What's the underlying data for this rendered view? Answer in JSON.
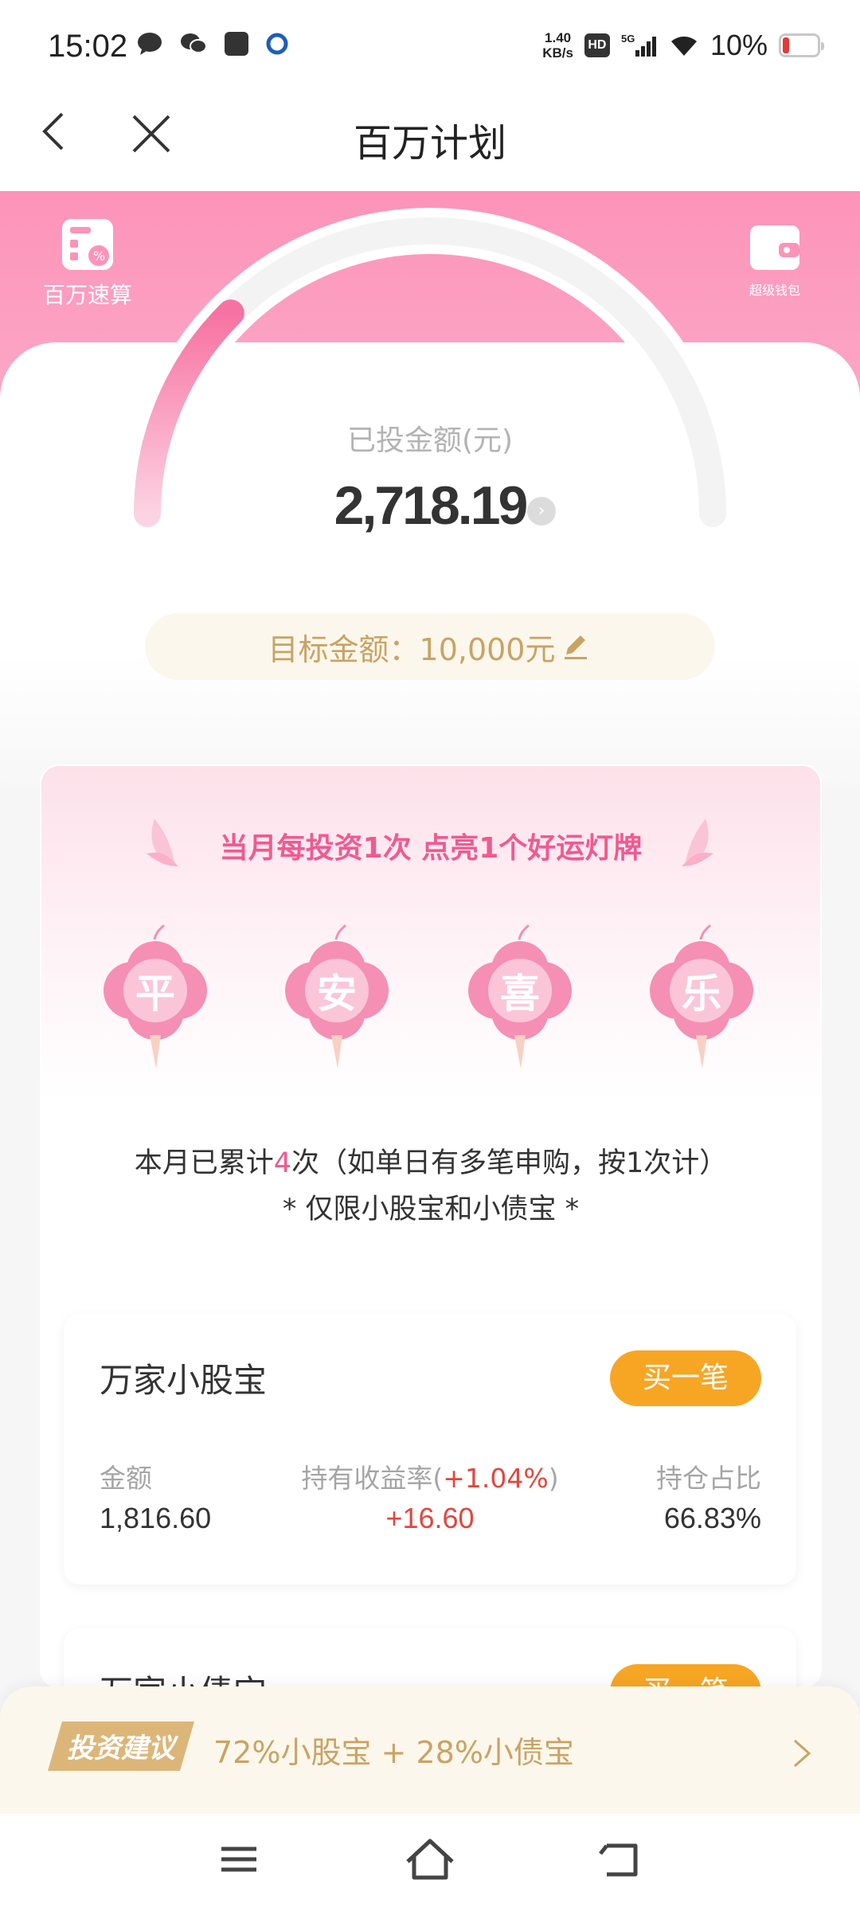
{
  "status_bar": {
    "time": "15:02",
    "net_speed_value": "1.40",
    "net_speed_unit": "KB/s",
    "hd": "HD",
    "signal": "5G",
    "battery": "10%"
  },
  "header": {
    "title": "百万计划"
  },
  "hero": {
    "quick_calc_label": "百万速算",
    "wallet_label": "超级钱包",
    "invested_label": "已投金额(元)",
    "invested_amount": "2,718.19",
    "progress": 0.27,
    "target_text": "目标金额：10,000元"
  },
  "lanterns": {
    "slogan": "当月每投资1次 点亮1个好运灯牌",
    "items": [
      "平",
      "安",
      "喜",
      "乐"
    ],
    "count_prefix": "本月已累计",
    "count_value": "4",
    "count_suffix": "次（如单日有多笔申购，按1次计）",
    "note": "* 仅限小股宝和小债宝 *"
  },
  "product1": {
    "name": "万家小股宝",
    "buy_label": "买一笔",
    "amount_label": "金额",
    "amount_value": "1,816.60",
    "yield_label_prefix": "持有收益率(",
    "yield_rate": "+1.04%",
    "yield_label_suffix": ")",
    "yield_value": "+16.60",
    "ratio_label": "持仓占比",
    "ratio_value": "66.83%"
  },
  "product2": {
    "name": "万家小债宝",
    "buy_label": "买一笔"
  },
  "suggestion": {
    "tag": "投资建议",
    "text": "72%小股宝 + 28%小债宝"
  },
  "colors": {
    "brand_pink": "#fd93b8",
    "accent_orange": "#f7a624",
    "gold_text": "#c9a364",
    "profit_red": "#e2463e"
  }
}
